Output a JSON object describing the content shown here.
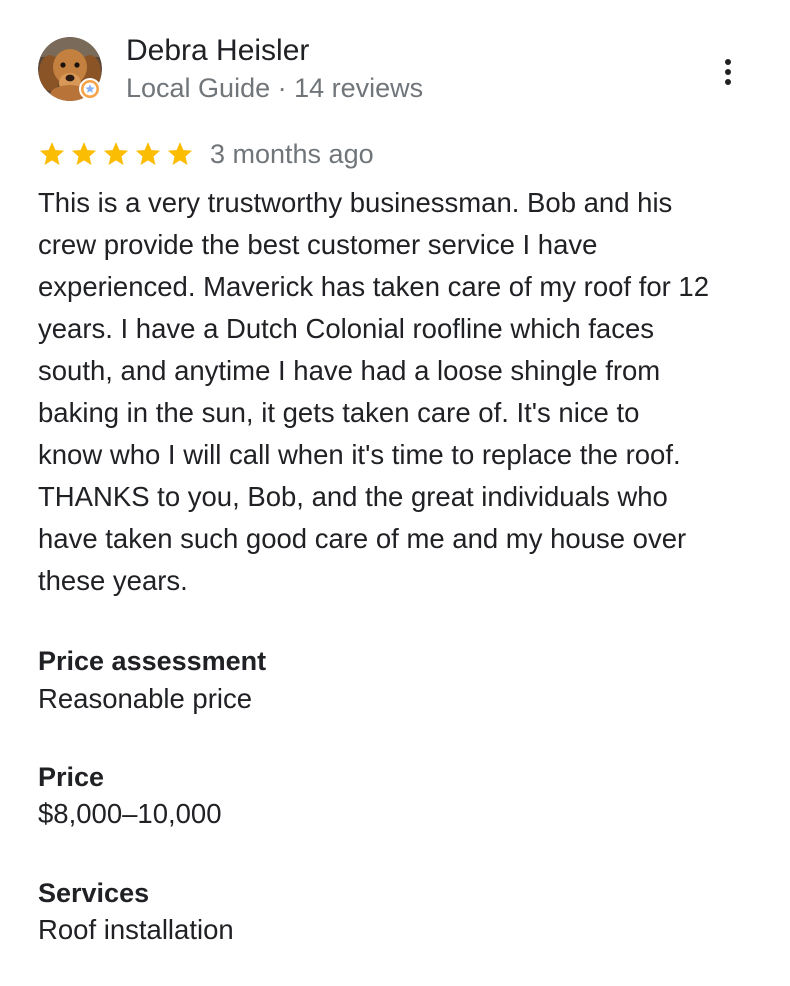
{
  "reviewer": {
    "name": "Debra Heisler",
    "subline": "Local Guide · 14 reviews",
    "avatar": "dog-avatar",
    "badge": "local-guide-star-icon"
  },
  "menu": {
    "icon": "more-vert-icon"
  },
  "rating": {
    "stars": 5,
    "max_stars": 5,
    "star_color": "#fbbc04",
    "age": "3 months ago"
  },
  "review": {
    "lines": [
      "This is a very trustworthy businessman. Bob and his",
      "crew provide the best customer service I have",
      "experienced. Maverick has taken care of my roof for 12",
      "years. I have a Dutch Colonial roofline which faces",
      "south, and anytime I have had a loose shingle from",
      "baking in the sun, it gets taken care of. It's nice to",
      "know who I will call when it's time to replace the roof.",
      "THANKS to you, Bob, and the great individuals who",
      "have taken such good care of me and my house over",
      "these years."
    ]
  },
  "attributes": [
    {
      "label": "Price assessment",
      "value": "Reasonable price"
    },
    {
      "label": "Price",
      "value": "$8,000–10,000"
    },
    {
      "label": "Services",
      "value": "Roof installation"
    }
  ],
  "colors": {
    "primary_text": "#202124",
    "secondary_text": "#70757a",
    "star": "#fbbc04"
  }
}
